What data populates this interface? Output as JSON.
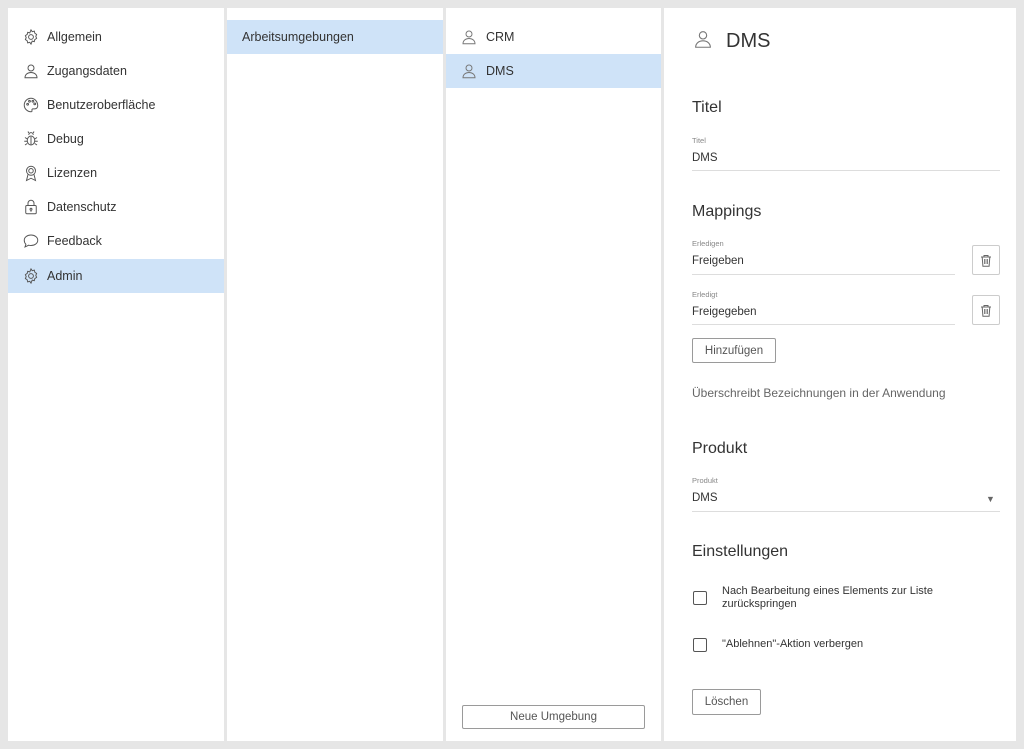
{
  "nav": {
    "items": [
      {
        "label": "Allgemein",
        "icon": "gear-icon"
      },
      {
        "label": "Zugangsdaten",
        "icon": "user-icon"
      },
      {
        "label": "Benutzeroberfläche",
        "icon": "palette-icon"
      },
      {
        "label": "Debug",
        "icon": "bug-icon"
      },
      {
        "label": "Lizenzen",
        "icon": "award-icon"
      },
      {
        "label": "Datenschutz",
        "icon": "lock-icon"
      },
      {
        "label": "Feedback",
        "icon": "chat-icon"
      },
      {
        "label": "Admin",
        "icon": "gear-icon"
      }
    ],
    "active": "Admin"
  },
  "submenu": {
    "items": [
      {
        "label": "Arbeitsumgebungen"
      }
    ]
  },
  "environments": {
    "items": [
      {
        "label": "CRM",
        "icon": "user-icon"
      },
      {
        "label": "DMS",
        "icon": "user-icon"
      }
    ],
    "active": "DMS",
    "new_button": "Neue Umgebung"
  },
  "detail": {
    "title": "DMS",
    "icon": "user-icon",
    "sections": {
      "titel": {
        "heading": "Titel",
        "field_label": "Titel",
        "field_value": "DMS"
      },
      "mappings": {
        "heading": "Mappings",
        "rows": [
          {
            "label": "Erledigen",
            "value": "Freigeben"
          },
          {
            "label": "Erledigt",
            "value": "Freigegeben"
          }
        ],
        "add_button": "Hinzufügen",
        "hint": "Überschreibt Bezeichnungen in der Anwendung"
      },
      "produkt": {
        "heading": "Produkt",
        "field_label": "Produkt",
        "field_value": "DMS"
      },
      "einstellungen": {
        "heading": "Einstellungen",
        "options": [
          {
            "label": "Nach Bearbeitung eines Elements zur Liste zurückspringen",
            "checked": false
          },
          {
            "label": "\"Ablehnen\"-Aktion verbergen",
            "checked": false
          }
        ]
      }
    },
    "delete_button": "Löschen"
  },
  "colors": {
    "accent": "#cfe3f8",
    "background": "#e6e6e6",
    "panel": "#ffffff"
  }
}
